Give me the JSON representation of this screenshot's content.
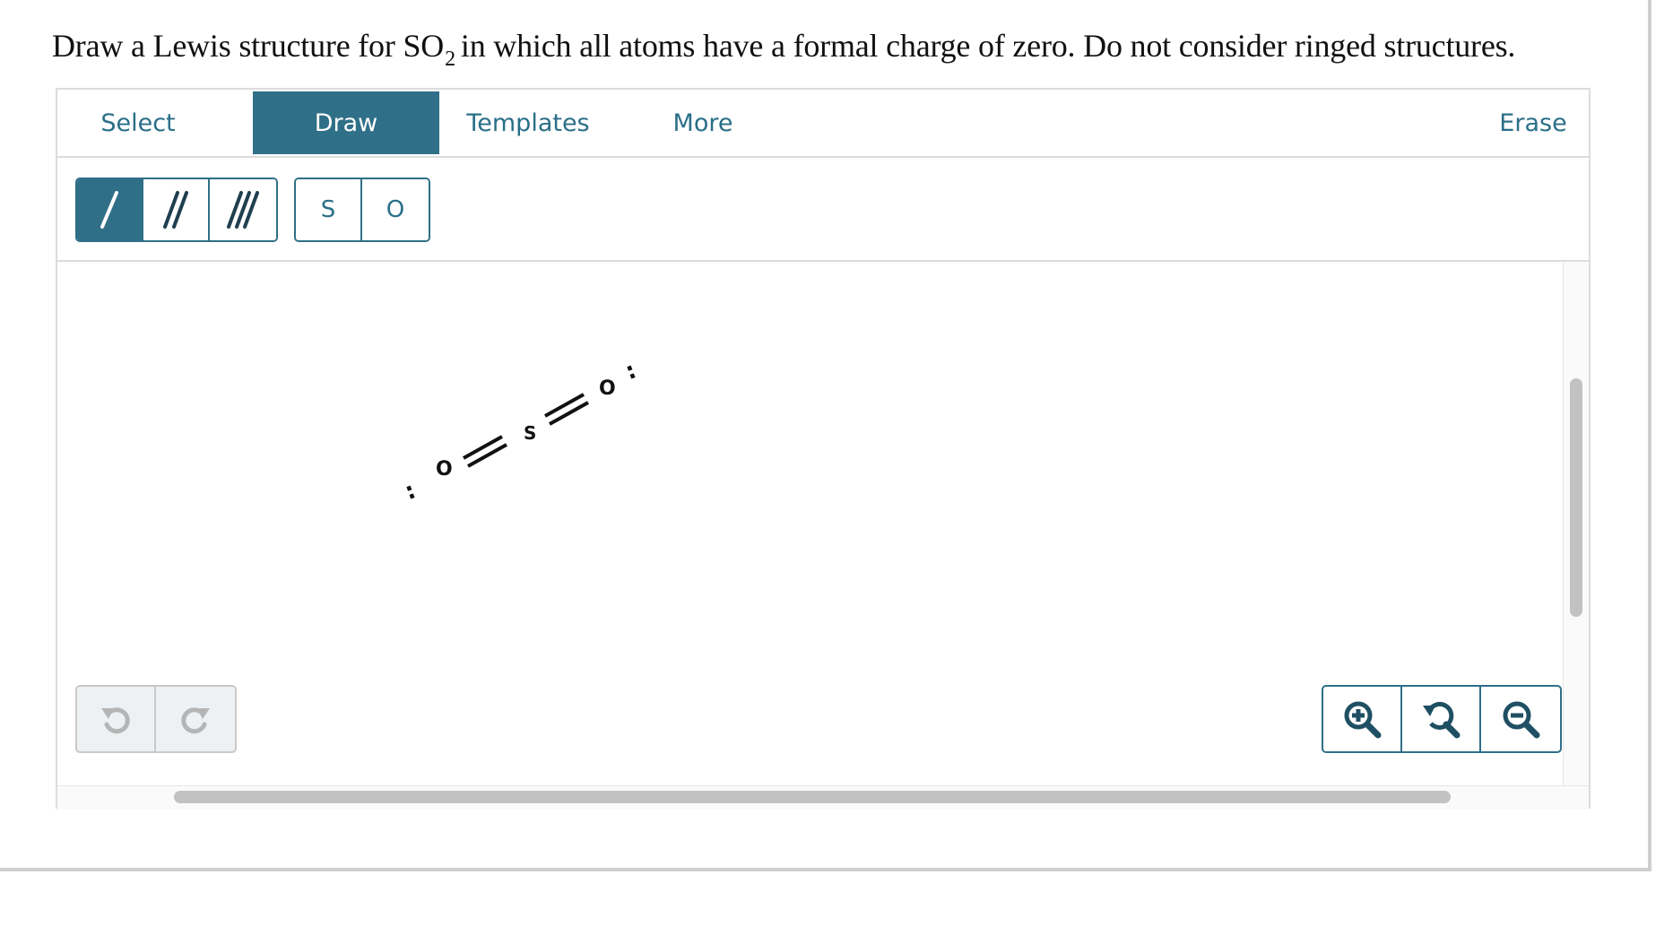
{
  "question": {
    "text_before": "Draw a Lewis structure for SO",
    "subscript": "2",
    "text_after": "in which all atoms have a formal charge of zero. Do not consider ringed structures."
  },
  "tabs": {
    "select": "Select",
    "draw": "Draw",
    "templates": "Templates",
    "more": "More",
    "erase": "Erase",
    "active": "Draw"
  },
  "bond_tools": [
    "single-bond",
    "double-bond",
    "triple-bond"
  ],
  "atom_tools": [
    "S",
    "O"
  ],
  "molecule": {
    "atoms": [
      "O",
      "S",
      "O"
    ],
    "bonds": [
      "double",
      "double"
    ],
    "lone_pairs": ":"
  },
  "colors": {
    "accent": "#2f6f88",
    "disabled": "#c9c9c9"
  },
  "icons": {
    "undo": "undo-icon",
    "redo": "redo-icon",
    "zoom_in": "zoom-in-icon",
    "zoom_reset": "zoom-reset-icon",
    "zoom_out": "zoom-out-icon"
  }
}
